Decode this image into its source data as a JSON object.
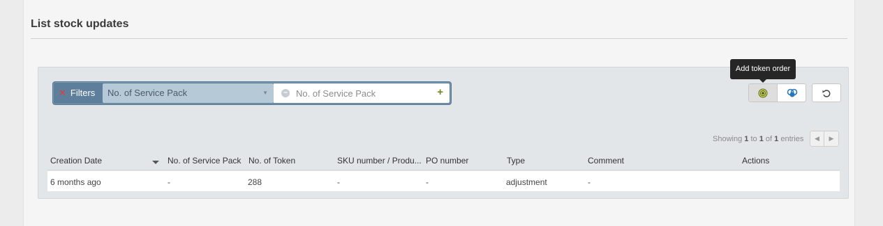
{
  "page": {
    "title": "List stock updates"
  },
  "filters": {
    "label": "Filters",
    "field_selected": "No. of Service Pack",
    "value_placeholder": "No. of Service Pack"
  },
  "toolbar": {
    "tooltip": "Add token order",
    "add_icon": "plus-circle-icon",
    "token_icon": "tokens-icon",
    "reset_icon": "undo-icon"
  },
  "pagination": {
    "prefix": "Showing",
    "from": "1",
    "to_label": "to",
    "to": "1",
    "of_label": "of",
    "total": "1",
    "suffix": "entries"
  },
  "table": {
    "columns": [
      "Creation Date",
      "No. of Service Pack",
      "No. of Token",
      "SKU number / Produ...",
      "PO number",
      "Type",
      "Comment",
      "Actions"
    ],
    "rows": [
      {
        "creation_date": "6 months ago",
        "service_pack": "-",
        "token": "288",
        "sku": "-",
        "po": "-",
        "type": "adjustment",
        "comment": "-"
      }
    ]
  },
  "colors": {
    "filter_bar": "#5e7f9b",
    "accent_green": "#6e8a1e",
    "token_blue": "#2a78b8"
  }
}
